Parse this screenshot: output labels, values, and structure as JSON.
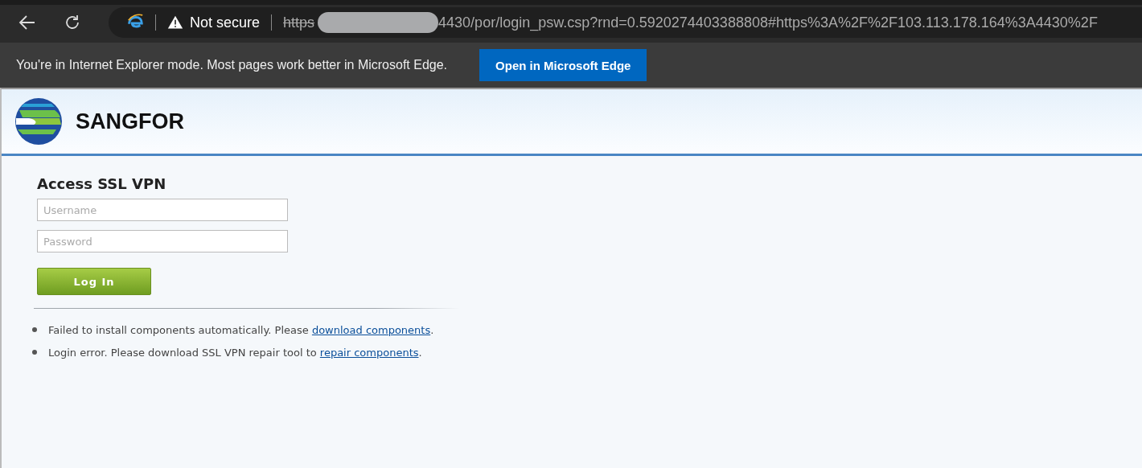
{
  "browser": {
    "security_label": "Not secure",
    "url_scheme": "https",
    "url_rest": "4430/por/login_psw.csp?rnd=0.5920274403388808#https%3A%2F%2F103.113.178.164%3A4430%2F"
  },
  "ie_bar": {
    "message": "You're in Internet Explorer mode. Most pages work better in Microsoft Edge.",
    "button": "Open in Microsoft Edge"
  },
  "header": {
    "brand": "SANGFOR"
  },
  "login": {
    "title": "Access SSL VPN",
    "username": {
      "placeholder": "Username"
    },
    "password": {
      "placeholder": "Password"
    },
    "button": "Log In"
  },
  "messages": [
    {
      "text": "Failed to install components automatically. Please ",
      "link": "download components",
      "after": "."
    },
    {
      "text": "Login error. Please download SSL VPN repair tool to ",
      "link": "repair components",
      "after": "."
    }
  ]
}
